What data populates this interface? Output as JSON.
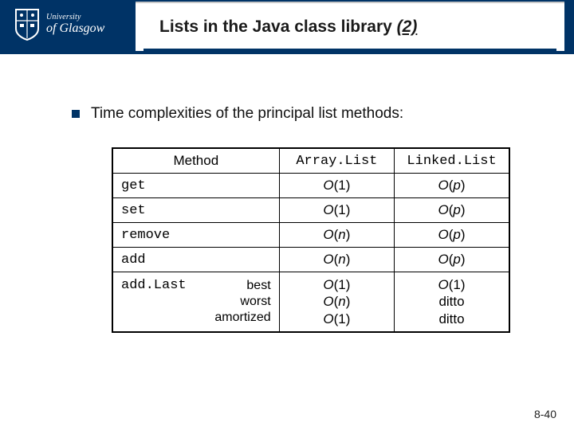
{
  "logo": {
    "small": "University",
    "big": "of Glasgow"
  },
  "title": {
    "main": "Lists in the Java class library ",
    "suffix": "(2)"
  },
  "bullet": "Time complexities of the principal list methods:",
  "table": {
    "headers": {
      "method": "Method",
      "arraylist": "Array.List",
      "linkedlist": "Linked.List"
    },
    "rows": {
      "get": {
        "m": "get",
        "a": "O(1)",
        "l": "O(p)"
      },
      "set": {
        "m": "set",
        "a": "O(1)",
        "l": "O(p)"
      },
      "remove": {
        "m": "remove",
        "a": "O(n)",
        "l": "O(p)"
      },
      "add": {
        "m": "add",
        "a": "O(n)",
        "l": "O(p)"
      },
      "addLast": {
        "m": "add.Last",
        "cases": {
          "best": "best",
          "worst": "worst",
          "amortized": "amortized"
        },
        "a": {
          "best": "O(1)",
          "worst": "O(n)",
          "amortized": "O(1)"
        },
        "l": {
          "best": "O(1)",
          "worst": "ditto",
          "amortized": "ditto"
        }
      }
    }
  },
  "pagenum": "8-40",
  "chart_data": {
    "type": "table",
    "title": "Time complexities of the principal list methods",
    "columns": [
      "Method",
      "Array.List",
      "Linked.List"
    ],
    "rows": [
      [
        "get",
        "O(1)",
        "O(p)"
      ],
      [
        "set",
        "O(1)",
        "O(p)"
      ],
      [
        "remove",
        "O(n)",
        "O(p)"
      ],
      [
        "add",
        "O(n)",
        "O(p)"
      ],
      [
        "add.Last (best)",
        "O(1)",
        "O(1)"
      ],
      [
        "add.Last (worst)",
        "O(n)",
        "ditto"
      ],
      [
        "add.Last (amortized)",
        "O(1)",
        "ditto"
      ]
    ]
  }
}
